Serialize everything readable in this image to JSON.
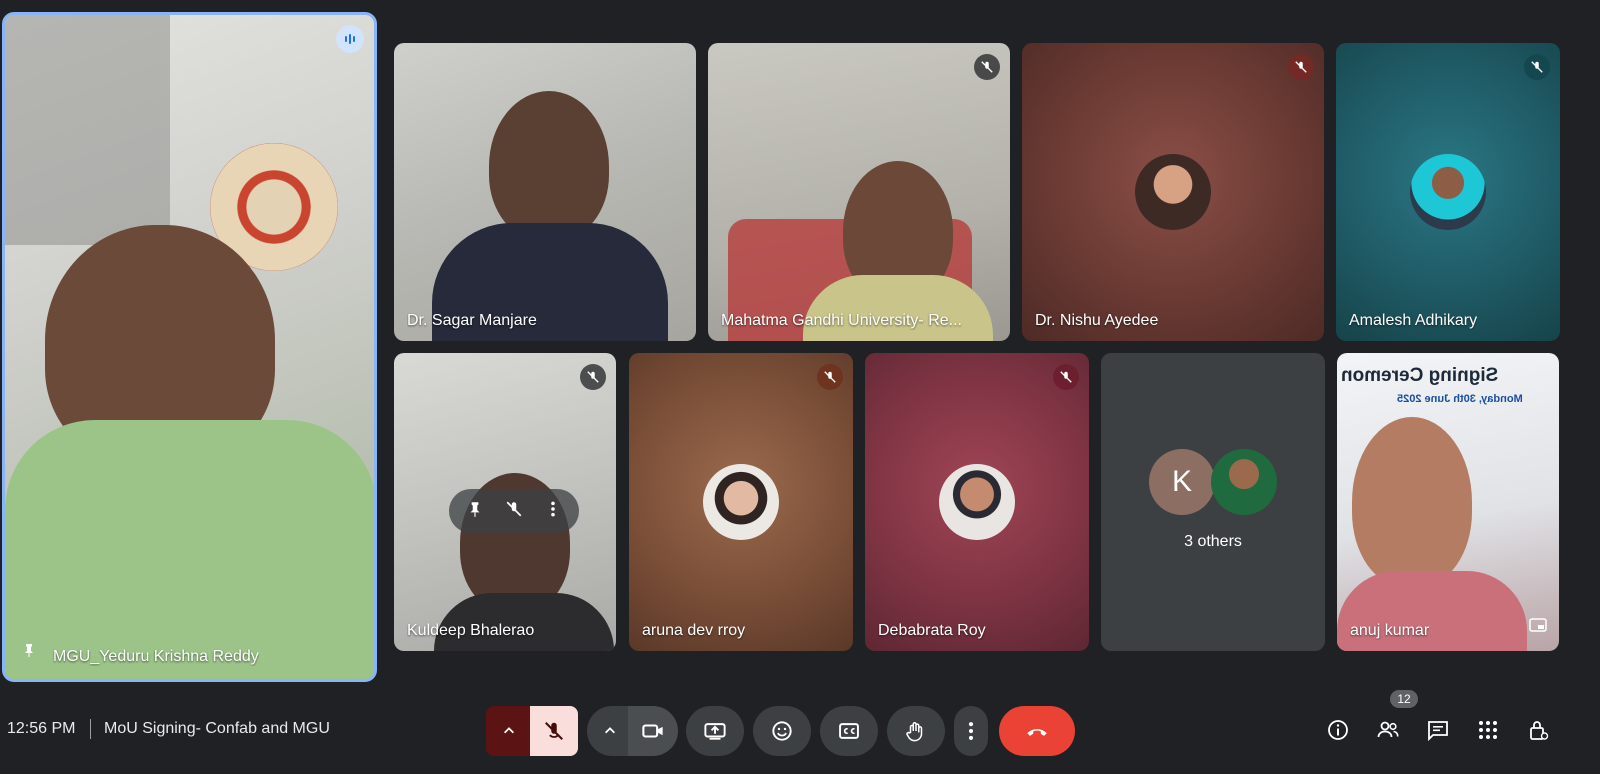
{
  "main_speaker": {
    "name": "MGU_Yeduru Krishna Reddy"
  },
  "tiles": [
    {
      "name": "Dr. Sagar Manjare"
    },
    {
      "name": "Mahatma Gandhi University- Re..."
    },
    {
      "name": "Dr. Nishu Ayedee"
    },
    {
      "name": "Amalesh Adhikary"
    },
    {
      "name": "Kuldeep Bhalerao"
    },
    {
      "name": "aruna dev rroy"
    },
    {
      "name": "Debabrata Roy"
    },
    {
      "name": "3 others",
      "avatar_letter": "K"
    },
    {
      "name": "anuj kumar"
    }
  ],
  "banner": {
    "line1": "Signing Ceremon",
    "line2": "Monday, 30th June 2025"
  },
  "meeting": {
    "time": "12:56 PM",
    "title": "MoU Signing- Confab and MGU"
  },
  "participants_count": "12",
  "colors": {
    "background": "#202124",
    "end_call": "#ea4335",
    "mic_off_bg": "#f9dedc",
    "tile_dark": "#3c4043"
  },
  "icons": {
    "mic_off": "mic-off-icon",
    "camera": "camera-icon",
    "present": "present-icon",
    "emoji": "emoji-icon",
    "captions": "captions-icon",
    "hand": "raise-hand-icon",
    "more": "more-vert-icon",
    "end": "end-call-icon",
    "info": "info-icon",
    "people": "people-icon",
    "chat": "chat-icon",
    "activities": "activities-icon",
    "lock": "host-controls-icon"
  }
}
